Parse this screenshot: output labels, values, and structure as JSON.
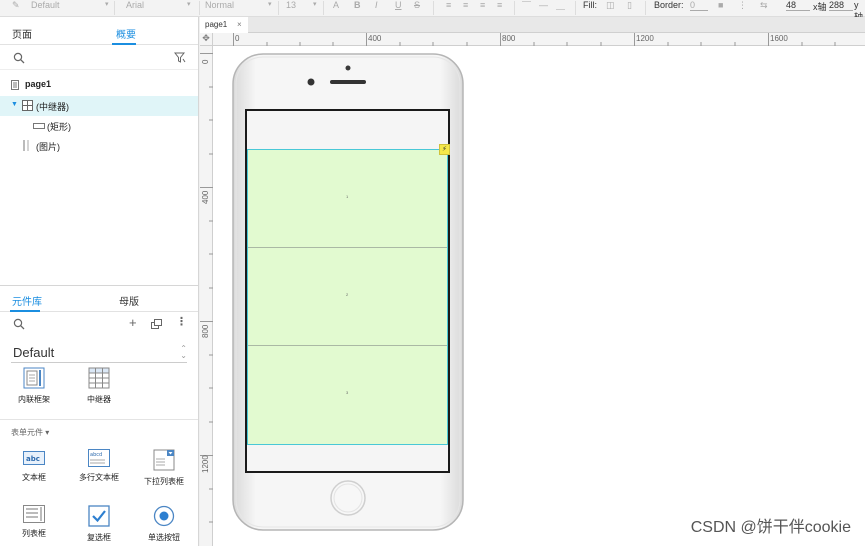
{
  "toolbar": {
    "style_select": "Default",
    "font_select": "Arial",
    "weight_select": "Normal",
    "size_select": "13",
    "fill_label": "Fill:",
    "border_label": "Border:",
    "border_value": "0",
    "x_value": "48",
    "x_label": "x轴",
    "y_value": "288",
    "y_label": "y轴"
  },
  "pages_panel": {
    "tab_pages": "页面",
    "tab_outline": "概要",
    "tree": [
      {
        "label": "page1"
      },
      {
        "label": "(中继器)"
      },
      {
        "label": "(矩形)"
      },
      {
        "label": "(图片)"
      }
    ]
  },
  "library_panel": {
    "tab_library": "元件库",
    "tab_masters": "母版",
    "library_name": "Default",
    "widgets_top": [
      {
        "label": "内联框架",
        "icon": "inline-frame-icon"
      },
      {
        "label": "中继器",
        "icon": "repeater-icon"
      }
    ],
    "section_label": "表单元件 ▾",
    "form_widgets": [
      {
        "label": "文本框",
        "icon": "text-field-icon",
        "icon_text": "abc"
      },
      {
        "label": "多行文本框",
        "icon": "text-area-icon",
        "icon_text": "abcd"
      },
      {
        "label": "下拉列表框",
        "icon": "droplist-icon"
      },
      {
        "label": "列表框",
        "icon": "list-box-icon"
      },
      {
        "label": "复选框",
        "icon": "checkbox-icon"
      },
      {
        "label": "单选按钮",
        "icon": "radio-button-icon"
      }
    ]
  },
  "canvas": {
    "doc_tab": "page1",
    "doc_tab_close": "×",
    "ruler_top": [
      "0",
      "400",
      "800",
      "1200",
      "1600"
    ],
    "ruler_left": [
      "0",
      "400",
      "800",
      "1200"
    ],
    "repeater_rows": [
      "1",
      "2",
      "3"
    ],
    "lightning_badge": "⚡"
  },
  "watermark": "CSDN @饼干伴cookie",
  "colors": {
    "accent": "#1b8ee0",
    "selection_bg": "#e0f5f8",
    "repeater_fill": "#e2fad0",
    "repeater_border": "#49c8d6",
    "badge": "#f5e84a"
  }
}
